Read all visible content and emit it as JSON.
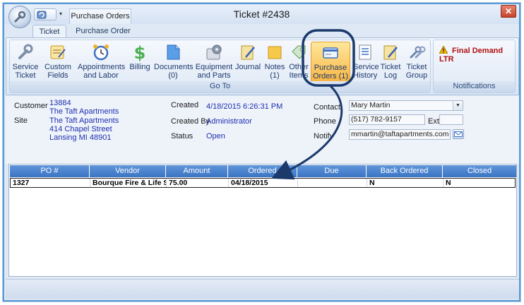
{
  "window": {
    "title": "Ticket #2438",
    "context_tab": "Purchase Orders",
    "close_glyph": "✕"
  },
  "ribbon_tabs": [
    {
      "label": "Ticket",
      "active": true
    },
    {
      "label": "Purchase Order",
      "active": false
    }
  ],
  "ribbon": {
    "group_goto_label": "Go To",
    "group_notifications_label": "Notifications",
    "buttons": [
      {
        "id": "service-ticket",
        "line1": "Service",
        "line2": "Ticket",
        "icon": "wrench-icon"
      },
      {
        "id": "custom-fields",
        "line1": "Custom",
        "line2": "Fields",
        "icon": "form-edit-icon"
      },
      {
        "id": "appointments-labor",
        "line1": "Appointments",
        "line2": "and Labor",
        "icon": "alarm-clock-icon"
      },
      {
        "id": "billing",
        "line1": "Billing",
        "line2": "",
        "icon": "dollar-icon"
      },
      {
        "id": "documents",
        "line1": "Documents",
        "line2": "(0)",
        "icon": "document-icon"
      },
      {
        "id": "equipment-parts",
        "line1": "Equipment",
        "line2": "and Parts",
        "icon": "gear-box-icon"
      },
      {
        "id": "journal",
        "line1": "Journal",
        "line2": "",
        "icon": "journal-pencil-icon"
      },
      {
        "id": "notes",
        "line1": "Notes",
        "line2": "(1)",
        "icon": "sticky-note-icon"
      },
      {
        "id": "other-items",
        "line1": "Other",
        "line2": "Items",
        "icon": "tag-icon"
      },
      {
        "id": "purchase-orders",
        "line1": "Purchase",
        "line2": "Orders (1)",
        "icon": "purchase-order-icon"
      },
      {
        "id": "service-history",
        "line1": "Service",
        "line2": "History",
        "icon": "history-list-icon"
      },
      {
        "id": "ticket-log",
        "line1": "Ticket",
        "line2": "Log",
        "icon": "log-pencil-icon"
      },
      {
        "id": "ticket-group",
        "line1": "Ticket",
        "line2": "Group",
        "icon": "tools-group-icon"
      }
    ],
    "notification": "Final Demand LTR"
  },
  "info": {
    "customer_label": "Customer",
    "customer_id": "13884",
    "customer_name": "The Taft Apartments",
    "site_label": "Site",
    "site_name": "The Taft Apartments",
    "site_street": "414 Chapel Street",
    "site_city": "Lansing MI 48901",
    "created_label": "Created",
    "created_value": "4/18/2015 6:26:31 PM",
    "created_by_label": "Created By",
    "created_by_value": "Administrator",
    "status_label": "Status",
    "status_value": "Open",
    "contact_label": "Contact",
    "contact_value": "Mary Martin",
    "phone_label": "Phone",
    "phone_value": "(517) 782-9157",
    "ext_label": "Ext",
    "ext_value": "",
    "notify_label": "Notify",
    "notify_value": "mmartin@taftapartments.com"
  },
  "grid": {
    "columns": [
      "PO #",
      "Vendor",
      "Amount",
      "Ordered",
      "Due",
      "Back Ordered",
      "Closed"
    ],
    "rows": [
      [
        "1327",
        "Bourque Fire & Life Saf...",
        "75.00",
        "04/18/2015",
        "",
        "N",
        "N"
      ]
    ]
  },
  "colors": {
    "header_blue": "#3a74c4",
    "link_blue": "#1f2fb0",
    "highlight_orange": "#f7b544",
    "annotation_navy": "#1b3a6b",
    "notification_red": "#b01010"
  }
}
